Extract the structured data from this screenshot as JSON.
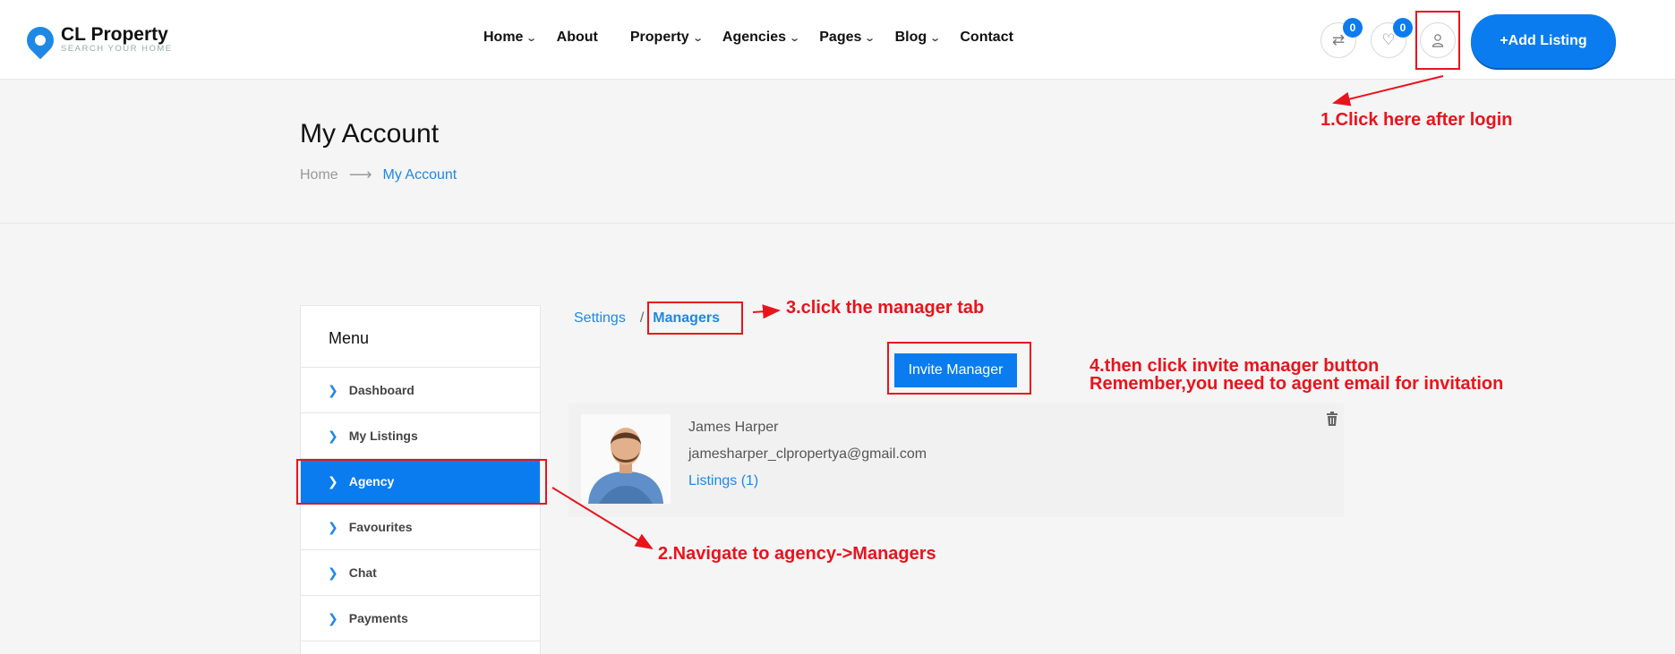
{
  "brand": {
    "name": "CL Property",
    "tagline": "SEARCH YOUR HOME"
  },
  "nav": [
    {
      "label": "Home",
      "dropdown": true
    },
    {
      "label": "About",
      "dropdown": false
    },
    {
      "label": "Property",
      "dropdown": true
    },
    {
      "label": "Agencies",
      "dropdown": true
    },
    {
      "label": "Pages",
      "dropdown": true
    },
    {
      "label": "Blog",
      "dropdown": true
    },
    {
      "label": "Contact",
      "dropdown": false
    }
  ],
  "header_actions": {
    "compare_count": "0",
    "favorites_count": "0",
    "add_listing_label": "+Add Listing"
  },
  "page": {
    "title": "My Account",
    "breadcrumb": {
      "home": "Home",
      "current": "My Account"
    }
  },
  "menu": {
    "title": "Menu",
    "items": [
      {
        "label": "Dashboard",
        "active": false
      },
      {
        "label": "My Listings",
        "active": false
      },
      {
        "label": "Agency",
        "active": true
      },
      {
        "label": "Favourites",
        "active": false
      },
      {
        "label": "Chat",
        "active": false
      },
      {
        "label": "Payments",
        "active": false
      }
    ]
  },
  "tabs": {
    "settings": "Settings",
    "separator": "/",
    "managers": "Managers"
  },
  "invite_button": "Invite Manager",
  "manager": {
    "name": "James Harper",
    "email": "jamesharper_clpropertya@gmail.com",
    "listings": "Listings (1)"
  },
  "annotations": {
    "step1": "1.Click here after login",
    "step2": "2.Navigate to agency->Managers",
    "step3": "3.click the manager tab",
    "step4_line1": "4.then click invite manager button",
    "step4_line2": "Remember,you need to agent email for invitation"
  },
  "colors": {
    "primary": "#0a7cf0",
    "annotation": "#e8141c"
  }
}
